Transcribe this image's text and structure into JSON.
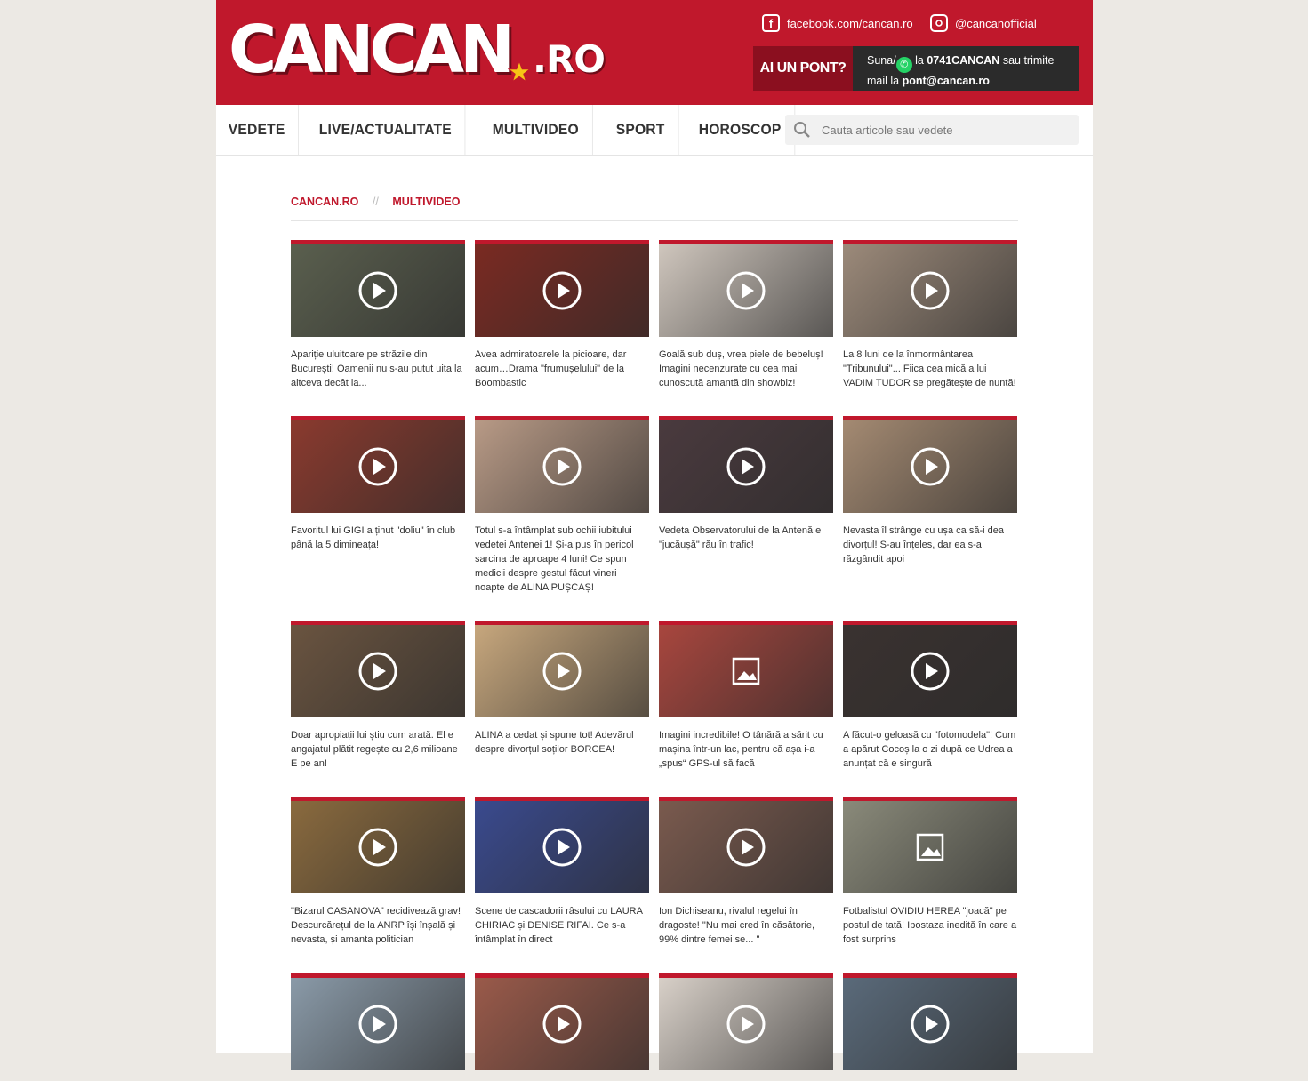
{
  "site": {
    "logo_main": "CANCAN",
    "logo_tld": ".RO"
  },
  "header": {
    "facebook": "facebook.com/cancan.ro",
    "instagram": "@cancanofficial",
    "pont_button": "AI UN PONT?",
    "pont_line1_a": "Suna/",
    "pont_line1_b": " la ",
    "pont_phone": "0741CANCAN",
    "pont_line1_c": " sau trimite",
    "pont_line2_a": "mail la ",
    "pont_email": "pont@cancan.ro"
  },
  "nav": {
    "items": [
      "VEDETE",
      "LIVE/ACTUALITATE",
      "MULTIVIDEO",
      "SPORT",
      "HOROSCOP"
    ],
    "search_placeholder": "Cauta articole sau vedete"
  },
  "breadcrumb": {
    "home": "CANCAN.RO",
    "separator": "//",
    "current": "MULTIVIDEO"
  },
  "colors": {
    "brand_red": "#c0182c",
    "dark_red": "#8b0f1f",
    "dark_box": "#2b2b2b"
  },
  "articles": [
    {
      "title": "Apariție uluitoare pe străzile din București! Oamenii nu s-au putut uita la altceva decât la...",
      "icon": "play-icon",
      "bg": "#5a5f4e"
    },
    {
      "title": "Avea admiratoarele la picioare, dar acum…Drama \"frumușelului\" de la Boombastic",
      "icon": "play-icon",
      "bg": "#7a2a22"
    },
    {
      "title": "Goală sub duș, vrea piele de bebeluș! Imagini necenzurate cu cea mai cunoscută amantă din showbiz!",
      "icon": "play-icon",
      "bg": "#cfc6bd"
    },
    {
      "title": "La 8 luni de la înmormântarea \"Tribunului\"... Fiica cea mică a lui VADIM TUDOR se pregătește de nuntă!",
      "icon": "play-icon",
      "bg": "#9c8a7a"
    },
    {
      "title": "Favoritul lui GIGI a ținut \"doliu\" în club până la 5 dimineața!",
      "icon": "play-icon",
      "bg": "#8a3a2e"
    },
    {
      "title": "Totul s-a întâmplat sub ochii iubitului vedetei Antenei 1! Și-a pus în pericol sarcina de aproape 4 luni! Ce spun medicii despre gestul făcut vineri noapte de ALINA PUȘCAȘ!",
      "icon": "play-icon",
      "bg": "#b89a86"
    },
    {
      "title": "Vedeta Observatorului de la Antenă e \"jucăușă\" rău în trafic!",
      "icon": "play-icon",
      "bg": "#4a3a3e"
    },
    {
      "title": "Nevasta îl strânge cu ușa ca să-i dea divorțul! S-au înțeles, dar ea s-a răzgândit apoi",
      "icon": "play-icon",
      "bg": "#a48a72"
    },
    {
      "title": "Doar apropiații lui știu cum arată. El e angajatul plătit regește cu 2,6 milioane E pe an!",
      "icon": "play-icon",
      "bg": "#6a5440"
    },
    {
      "title": "ALINA a cedat și spune tot! Adevărul despre divorțul soților BORCEA!",
      "icon": "play-icon",
      "bg": "#c7a77d"
    },
    {
      "title": "Imagini incredibile! O tânără a sărit cu mașina într-un lac, pentru că așa i-a „spus“ GPS-ul să facă",
      "icon": "gallery-icon",
      "bg": "#a8463e"
    },
    {
      "title": "A făcut-o geloasă cu \"fotomodela\"! Cum a apărut Cocoș la o zi după ce Udrea a anunțat că e singură",
      "icon": "play-icon",
      "bg": "#3a3230"
    },
    {
      "title": "\"Bizarul CASANOVA\" recidivează grav! Descurcărețul de la ANRP își înșală și nevasta, și amanta politician",
      "icon": "play-icon",
      "bg": "#8a6a3e"
    },
    {
      "title": "Scene de cascadorii râsului cu LAURA CHIRIAC și DENISE RIFAI. Ce s-a întâmplat în direct",
      "icon": "play-icon",
      "bg": "#3a4a8e"
    },
    {
      "title": "Ion Dichiseanu, rivalul regelui în dragoste! \"Nu mai cred în căsătorie, 99% dintre femei se... \"",
      "icon": "play-icon",
      "bg": "#7a5a4e"
    },
    {
      "title": "Fotbalistul OVIDIU HEREA \"joacă\" pe postul de tată! Ipostaza inedită în care a fost surprins",
      "icon": "gallery-icon",
      "bg": "#8a8a7a"
    },
    {
      "title": "",
      "icon": "play-icon",
      "bg": "#8a9aa8"
    },
    {
      "title": "",
      "icon": "play-icon",
      "bg": "#9a5a4a"
    },
    {
      "title": "",
      "icon": "play-icon",
      "bg": "#d8d0c8"
    },
    {
      "title": "",
      "icon": "play-icon",
      "bg": "#5a6a7a"
    }
  ]
}
